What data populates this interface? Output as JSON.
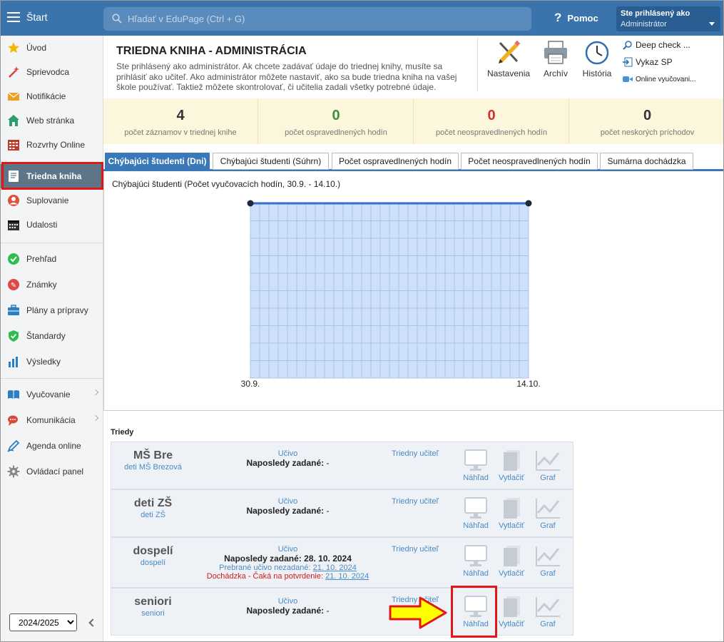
{
  "topbar": {
    "start_label": "Štart",
    "search_placeholder": "Hľadať v EduPage (Ctrl + G)",
    "help_label": "Pomoc",
    "user_line1": "Ste prihlásený ako",
    "user_line2": "Administrátor"
  },
  "sidebar": {
    "items": [
      {
        "label": "Úvod",
        "icon": "star-icon"
      },
      {
        "label": "Sprievodca",
        "icon": "wand-icon"
      },
      {
        "label": "Notifikácie",
        "icon": "envelope-icon"
      },
      {
        "label": "Web stránka",
        "icon": "house-icon"
      },
      {
        "label": "Rozvrhy Online",
        "icon": "timetable-icon"
      },
      {
        "label": "Triedna kniha",
        "icon": "book-icon"
      },
      {
        "label": "Suplovanie",
        "icon": "person-icon"
      },
      {
        "label": "Udalosti",
        "icon": "calendar-icon"
      },
      {
        "label": "Prehľad",
        "icon": "check-circle-icon"
      },
      {
        "label": "Známky",
        "icon": "grades-icon"
      },
      {
        "label": "Plány a prípravy",
        "icon": "briefcase-icon"
      },
      {
        "label": "Štandardy",
        "icon": "shield-check-icon"
      },
      {
        "label": "Výsledky",
        "icon": "bar-chart-icon"
      },
      {
        "label": "Vyučovanie",
        "icon": "open-book-icon"
      },
      {
        "label": "Komunikácia",
        "icon": "chat-icon"
      },
      {
        "label": "Agenda online",
        "icon": "pen-icon"
      },
      {
        "label": "Ovládací panel",
        "icon": "gear-icon"
      }
    ],
    "year": "2024/2025",
    "year_options": [
      "2024/2025"
    ]
  },
  "header": {
    "title": "TRIEDNA KNIHA - ADMINISTRÁCIA",
    "description": "Ste prihlásený ako administrátor. Ak chcete zadávať údaje do triednej knihy, musíte sa prihlásiť ako učiteľ. Ako administrátor môžete nastaviť, ako sa bude triedna kniha na vašej škole používať. Taktiež môžete skontrolovať, či učitelia zadali všetky potrebné údaje.",
    "tools": {
      "settings": "Nastavenia",
      "archive": "Archív",
      "history": "História"
    },
    "side_tools": {
      "deep_check": "Deep check ...",
      "vykaz": "Vykaz SP",
      "online": "Online vyučovani..."
    }
  },
  "stats": [
    {
      "value": "4",
      "caption": "počet záznamov v triednej knihe",
      "color": "#333333"
    },
    {
      "value": "0",
      "caption": "počet ospravedlnených hodín",
      "color": "#3f8f3f"
    },
    {
      "value": "0",
      "caption": "počet neospravedlnených hodín",
      "color": "#d32f2f"
    },
    {
      "value": "0",
      "caption": "počet neskorých príchodov",
      "color": "#333333"
    }
  ],
  "tabs": [
    "Chýbajúci študenti (Dni)",
    "Chýbajúci študenti (Súhrn)",
    "Počet ospravedlnených hodín",
    "Počet neospravedlnených hodín",
    "Sumárna dochádzka"
  ],
  "chart_data": {
    "type": "line",
    "title": "Chýbajúci študenti (Počet vyučovacích hodín, 30.9. - 14.10.)",
    "x": [
      "30.9.",
      "14.10."
    ],
    "series": [
      {
        "values": [
          0,
          0
        ]
      }
    ],
    "grid": true
  },
  "classes_label": "Triedy",
  "classes": [
    {
      "name": "MŠ Bre",
      "sub": "deti MŠ Brezová",
      "ucivo": "Učivo",
      "last_label": "Naposledy zadané:",
      "last_value": "-",
      "teacher": "Triedny učiteľ"
    },
    {
      "name": "deti ZŠ",
      "sub": "deti ZŠ",
      "ucivo": "Učivo",
      "last_label": "Naposledy zadané:",
      "last_value": "-",
      "teacher": "Triedny učiteľ"
    },
    {
      "name": "dospelí",
      "sub": "dospelí",
      "ucivo": "Učivo",
      "last_label": "Naposledy zadané:",
      "last_value": "28. 10. 2024",
      "teacher": "Triedny učiteľ",
      "extra1_label": "Prebrané učivo nezadané:",
      "extra1_date": "21. 10. 2024",
      "extra2_label": "Dochádzka - Čaká na potvrdenie:",
      "extra2_date": "21. 10. 2024"
    },
    {
      "name": "seniori",
      "sub": "seniori",
      "ucivo": "Učivo",
      "last_label": "Naposledy zadané:",
      "last_value": "-",
      "teacher": "Triedny učiteľ"
    }
  ],
  "actions": {
    "preview": "Náhľad",
    "print": "Vytlačiť",
    "graph": "Graf"
  },
  "colors": {
    "topbar": "#3b73ad",
    "accent": "#3b78b8",
    "highlight": "#e01818",
    "arrow": "#ffff00"
  }
}
